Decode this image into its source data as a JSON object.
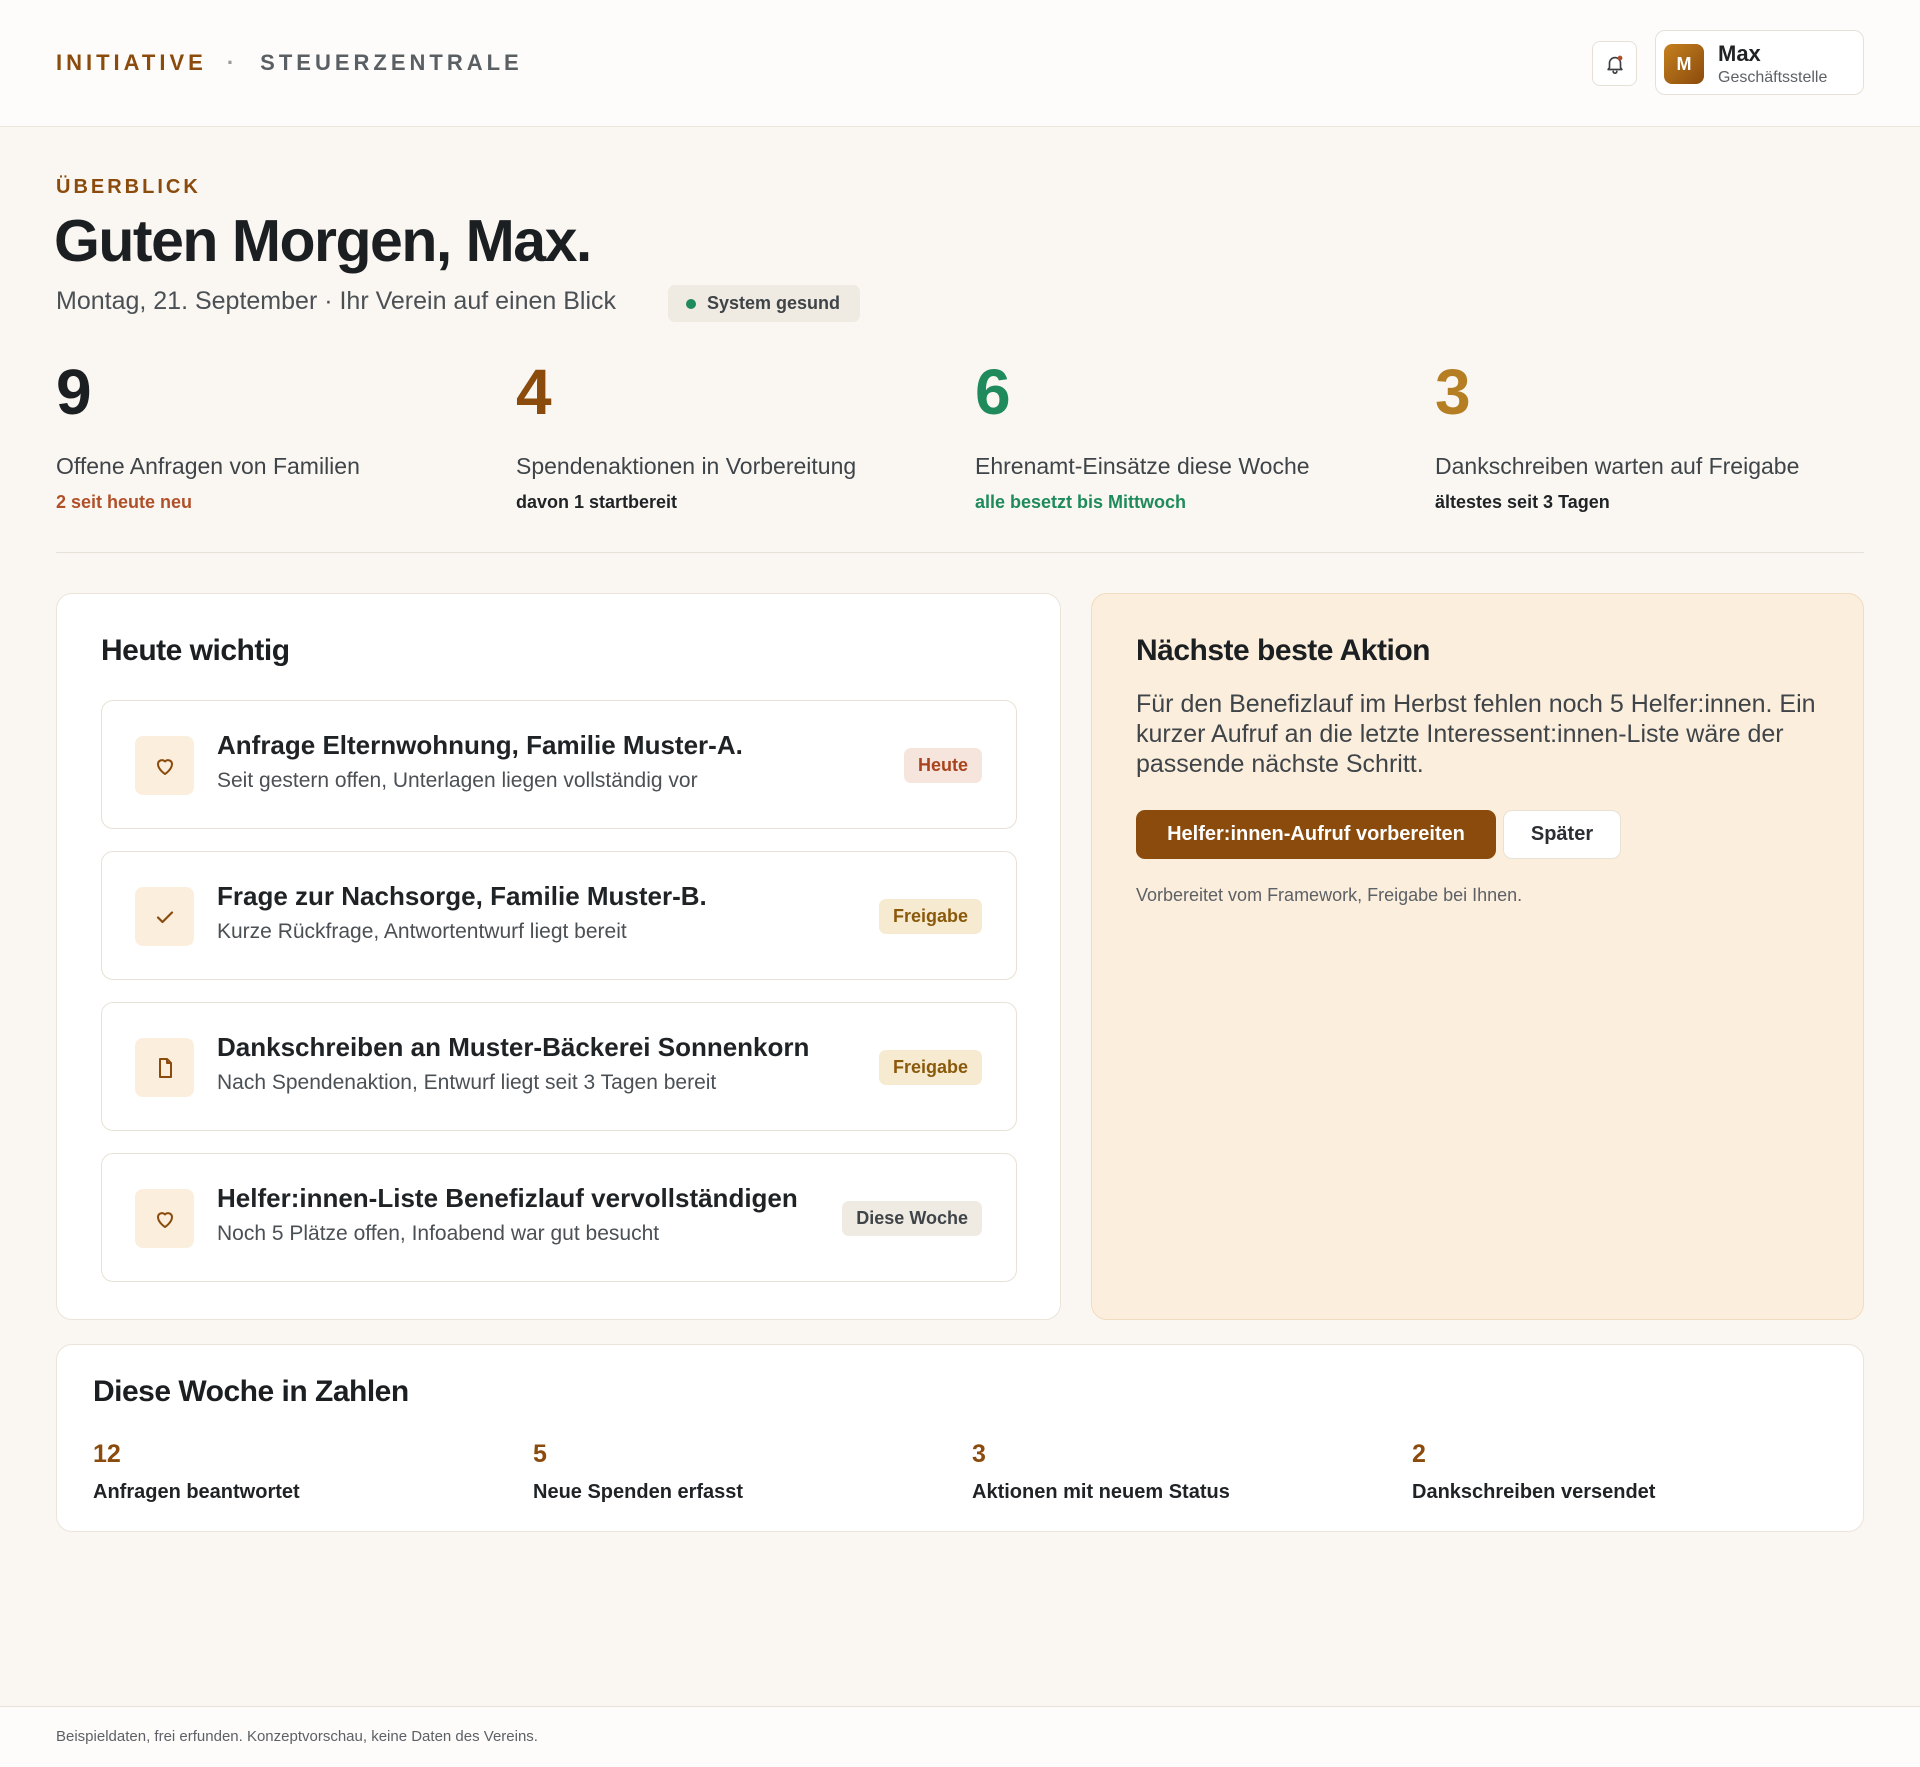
{
  "header": {
    "brand_primary": "INITIATIVE",
    "brand_separator": "·",
    "brand_secondary": "STEUERZENTRALE",
    "bell_icon": "bell-icon",
    "user": {
      "initial": "M",
      "name": "Max",
      "role": "Geschäftsstelle"
    }
  },
  "hero": {
    "eyebrow": "ÜBERBLICK",
    "title": "Guten Morgen, Max.",
    "subtitle": "Montag, 21. September · Ihr Verein auf einen Blick",
    "status_badge": "System gesund",
    "status_color": "#1f8a5b"
  },
  "kpis": [
    {
      "value": "9",
      "label": "Offene Anfragen von Familien",
      "note": "2 seit heute neu",
      "value_color": "#1b1f22",
      "note_color": "#b0502a"
    },
    {
      "value": "4",
      "label": "Spendenaktionen in Vorbereitung",
      "note": "davon 1 startbereit",
      "value_color": "#8a4b0c",
      "note_color": "#1f2326"
    },
    {
      "value": "6",
      "label": "Ehrenamt-Einsätze diese Woche",
      "note": "alle besetzt bis Mittwoch",
      "value_color": "#1f8a5b",
      "note_color": "#1f8a5b"
    },
    {
      "value": "3",
      "label": "Dankschreiben warten auf Freigabe",
      "note": "ältestes seit 3 Tagen",
      "value_color": "#b57e22",
      "note_color": "#1f2326"
    }
  ],
  "today": {
    "title": "Heute wichtig",
    "tasks": [
      {
        "icon": "heart-icon",
        "title": "Anfrage Elternwohnung, Familie Muster-A.",
        "subtitle": "Seit gestern offen, Unterlagen liegen vollständig vor",
        "badge": "Heute",
        "badge_bg": "#f6e5dc",
        "badge_fg": "#a8441e"
      },
      {
        "icon": "check-icon",
        "title": "Frage zur Nachsorge, Familie Muster-B.",
        "subtitle": "Kurze Rückfrage, Antwortentwurf liegt bereit",
        "badge": "Freigabe",
        "badge_bg": "#f6ead0",
        "badge_fg": "#8a5a0c"
      },
      {
        "icon": "document-icon",
        "title": "Dankschreiben an Muster-Bäckerei Sonnenkorn",
        "subtitle": "Nach Spendenaktion, Entwurf liegt seit 3 Tagen bereit",
        "badge": "Freigabe",
        "badge_bg": "#f6ead0",
        "badge_fg": "#8a5a0c"
      },
      {
        "icon": "heart-icon",
        "title": "Helfer:innen-Liste Benefizlauf vervollständigen",
        "subtitle": "Noch 5 Plätze offen, Infoabend war gut besucht",
        "badge": "Diese Woche",
        "badge_bg": "#efeae2",
        "badge_fg": "#3f4448"
      }
    ]
  },
  "next_action": {
    "title": "Nächste beste Aktion",
    "text": "Für den Benefizlauf im Herbst fehlen noch 5 Helfer:innen. Ein kurzer Aufruf an die letzte Interessent:innen-Liste wäre der passende nächste Schritt.",
    "primary_button": "Helfer:innen-Aufruf vorbereiten",
    "secondary_button": "Später",
    "note": "Vorbereitet vom Framework, Freigabe bei Ihnen."
  },
  "week": {
    "title": "Diese Woche in Zahlen",
    "stats": [
      {
        "value": "12",
        "label": "Anfragen beantwortet"
      },
      {
        "value": "5",
        "label": "Neue Spenden erfasst"
      },
      {
        "value": "3",
        "label": "Aktionen mit neuem Status"
      },
      {
        "value": "2",
        "label": "Dankschreiben versendet"
      }
    ]
  },
  "footer": {
    "text": "Beispieldaten, frei erfunden. Konzeptvorschau, keine Daten des Vereins."
  },
  "colors": {
    "accent": "#8a4b0c",
    "background": "#faf7f2",
    "card_highlight": "#fbeedd"
  }
}
